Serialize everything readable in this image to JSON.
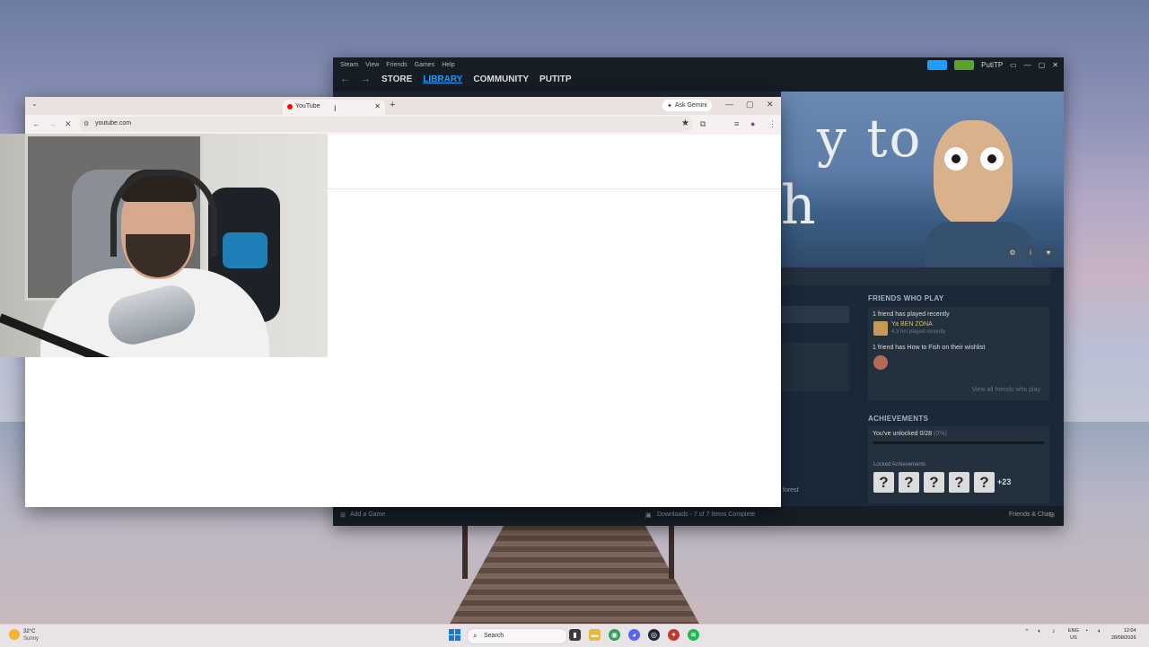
{
  "steam": {
    "menu": [
      "Steam",
      "View",
      "Friends",
      "Games",
      "Help"
    ],
    "nav": [
      "STORE",
      "LIBRARY",
      "COMMUNITY",
      "PUTITP"
    ],
    "user": "PutiTP",
    "hero_title_line1": "y to",
    "hero_title_line2": "h",
    "friends_who_play": {
      "title": "FRIENDS WHO PLAY",
      "recent_heading": "1 friend has played recently",
      "friend_name": "Ya BEN ZONA",
      "friend_hours": "4.3 hrs played recently",
      "wishlist_heading": "1 friend has How to Fish on their wishlist",
      "view_all": "View all friends who play"
    },
    "achievements": {
      "title": "ACHIEVEMENTS",
      "unlocked": "You've unlocked 0/28",
      "unlocked_pct": "(0%)",
      "locked_label": "Locked Achievements",
      "more": "+23"
    },
    "forest_text": "forest",
    "footer": {
      "add_game": "Add a Game",
      "downloads": "Downloads - 7 of 7 Items Complete",
      "friends_chat": "Friends & Chat"
    }
  },
  "chrome": {
    "tab_title": "YouTube",
    "new_tab": "+",
    "gemini": "Ask Gemini",
    "url": "youtube.com"
  },
  "taskbar": {
    "temp": "32°C",
    "weather_sub": "Sunny",
    "search": "Search",
    "lang_top": "ENG",
    "lang_bottom": "US",
    "time": "12:04",
    "date": "28/08/2026"
  }
}
